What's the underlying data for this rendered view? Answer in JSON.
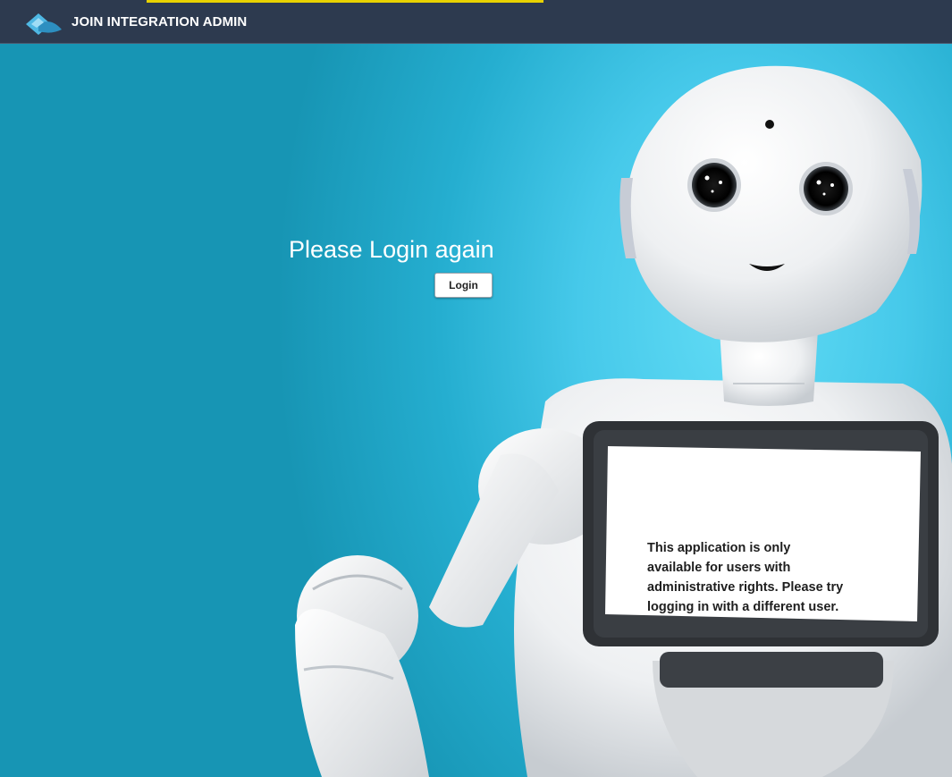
{
  "header": {
    "app_title": "JOIN INTEGRATION ADMIN",
    "logo_icon": "join-logo-icon",
    "accent_color": "#e8d200",
    "background_color": "#2d3a4f"
  },
  "main": {
    "title": "Please Login again",
    "login_button_label": "Login",
    "robot_screen_message": "This application is only available for users with administrative rights. Please try logging in with a different user.",
    "background_color": "#1e9dbd"
  }
}
